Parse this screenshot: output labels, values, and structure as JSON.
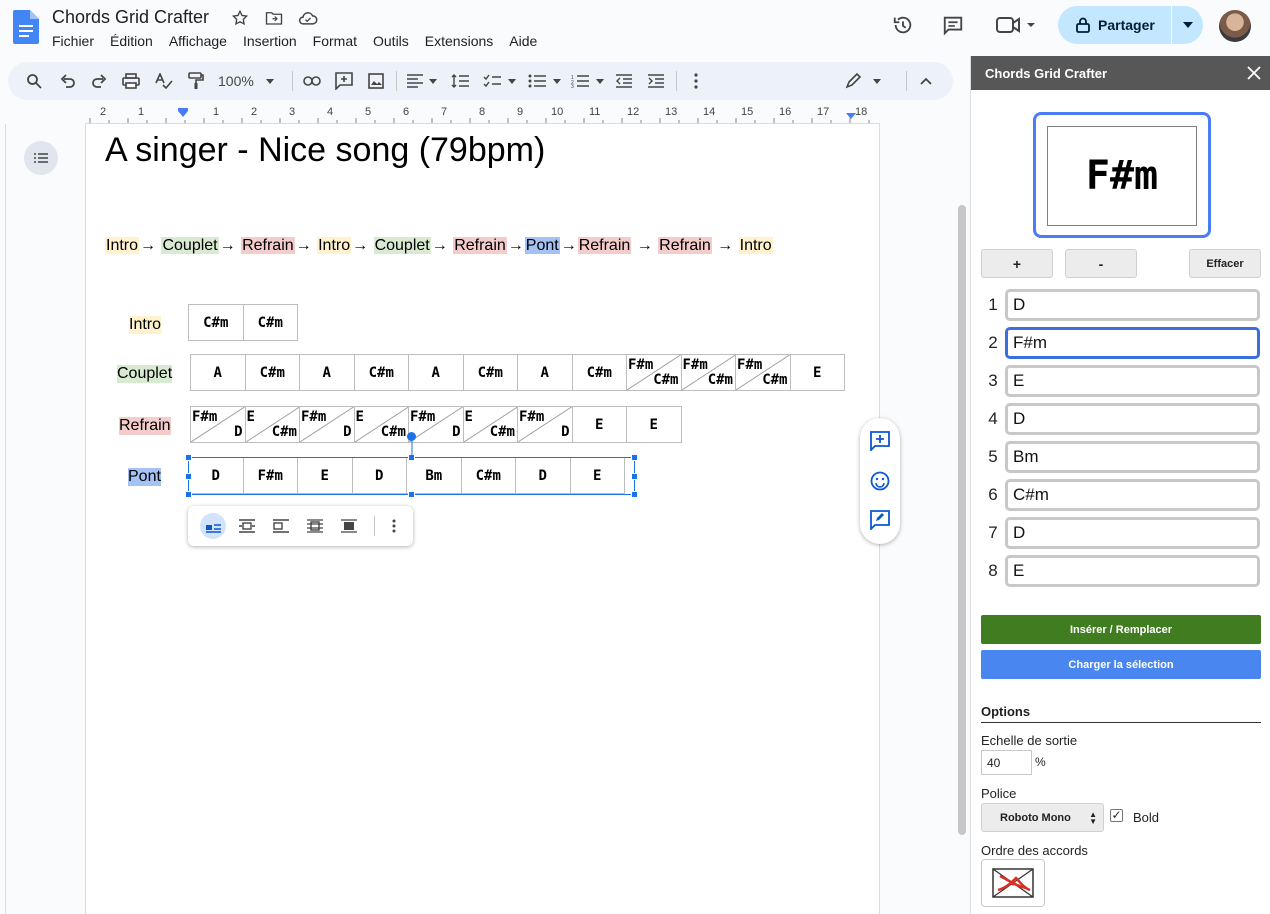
{
  "app": {
    "doc_title": "Chords Grid Crafter",
    "menu": [
      "Fichier",
      "Édition",
      "Affichage",
      "Insertion",
      "Format",
      "Outils",
      "Extensions",
      "Aide"
    ],
    "share_label": "Partager"
  },
  "toolbar": {
    "zoom": "100%"
  },
  "ruler": {
    "numbers": [
      "2",
      "1",
      "1",
      "2",
      "3",
      "4",
      "5",
      "6",
      "7",
      "8",
      "9",
      "10",
      "11",
      "12",
      "13",
      "14",
      "15",
      "16",
      "17",
      "18"
    ]
  },
  "document": {
    "heading": "A singer - Nice song (79bpm)",
    "structure": [
      {
        "text": "Intro",
        "type": "intro"
      },
      {
        "text": "→ ",
        "type": "arrow"
      },
      {
        "text": "Couplet",
        "type": "couplet"
      },
      {
        "text": "→ ",
        "type": "arrow"
      },
      {
        "text": "Refrain",
        "type": "refrain"
      },
      {
        "text": "→ ",
        "type": "arrow"
      },
      {
        "text": "Intro",
        "type": "intro"
      },
      {
        "text": "→ ",
        "type": "arrow"
      },
      {
        "text": "Couplet",
        "type": "couplet"
      },
      {
        "text": "→ ",
        "type": "arrow"
      },
      {
        "text": "Refrain",
        "type": "refrain"
      },
      {
        "text": "→",
        "type": "arrow"
      },
      {
        "text": "Pont",
        "type": "pont"
      },
      {
        "text": "→",
        "type": "arrow"
      },
      {
        "text": "Refrain",
        "type": "refrain"
      },
      {
        "text": " → ",
        "type": "arrow"
      },
      {
        "text": "Refrain",
        "type": "refrain"
      },
      {
        "text": " → ",
        "type": "arrow"
      },
      {
        "text": "Intro",
        "type": "intro"
      }
    ],
    "sections": [
      {
        "label": "Intro",
        "type": "intro",
        "cells": [
          [
            "C#m"
          ],
          [
            "C#m"
          ]
        ]
      },
      {
        "label": "Couplet",
        "type": "couplet",
        "cells": [
          [
            "A"
          ],
          [
            "C#m"
          ],
          [
            "A"
          ],
          [
            "C#m"
          ],
          [
            "A"
          ],
          [
            "C#m"
          ],
          [
            "A"
          ],
          [
            "C#m"
          ],
          [
            "F#m",
            "C#m"
          ],
          [
            "F#m",
            "C#m"
          ],
          [
            "F#m",
            "C#m"
          ],
          [
            "E"
          ]
        ]
      },
      {
        "label": "Refrain",
        "type": "refrain",
        "cells": [
          [
            "F#m",
            "D"
          ],
          [
            "E",
            "C#m"
          ],
          [
            "F#m",
            "D"
          ],
          [
            "E",
            "C#m"
          ],
          [
            "F#m",
            "D"
          ],
          [
            "E",
            "C#m"
          ],
          [
            "F#m",
            "D"
          ],
          [
            "E"
          ],
          [
            "E"
          ]
        ]
      },
      {
        "label": "Pont",
        "type": "pont",
        "cells": [
          [
            "D"
          ],
          [
            "F#m"
          ],
          [
            "E"
          ],
          [
            "D"
          ],
          [
            "Bm"
          ],
          [
            "C#m"
          ],
          [
            "D"
          ],
          [
            "E"
          ]
        ]
      }
    ]
  },
  "sidebar": {
    "title": "Chords Grid Crafter",
    "preview_chord": "F#m",
    "btn_plus": "+",
    "btn_minus": "-",
    "btn_clear": "Effacer",
    "chords": [
      {
        "num": "1",
        "value": "D",
        "active": false
      },
      {
        "num": "2",
        "value": "F#m",
        "active": true
      },
      {
        "num": "3",
        "value": "E",
        "active": false
      },
      {
        "num": "4",
        "value": "D",
        "active": false
      },
      {
        "num": "5",
        "value": "Bm",
        "active": false
      },
      {
        "num": "6",
        "value": "C#m",
        "active": false
      },
      {
        "num": "7",
        "value": "D",
        "active": false
      },
      {
        "num": "8",
        "value": "E",
        "active": false
      }
    ],
    "btn_insert": "Insérer / Remplacer",
    "btn_load": "Charger la sélection",
    "options_title": "Options",
    "scale_label": "Echelle de sortie",
    "scale_value": "40",
    "scale_unit": "%",
    "font_label": "Police",
    "font_value": "Roboto Mono",
    "bold_label": "Bold",
    "bold_checked": true,
    "order_label": "Ordre des accords"
  },
  "colors": {
    "intro": "#fff2cc",
    "couplet": "#d9ead3",
    "refrain": "#f4cccc",
    "pont": "#a4c2f4",
    "insert_btn": "#3f7d20",
    "load_btn": "#4a86f0",
    "accent": "#1a73e8"
  }
}
